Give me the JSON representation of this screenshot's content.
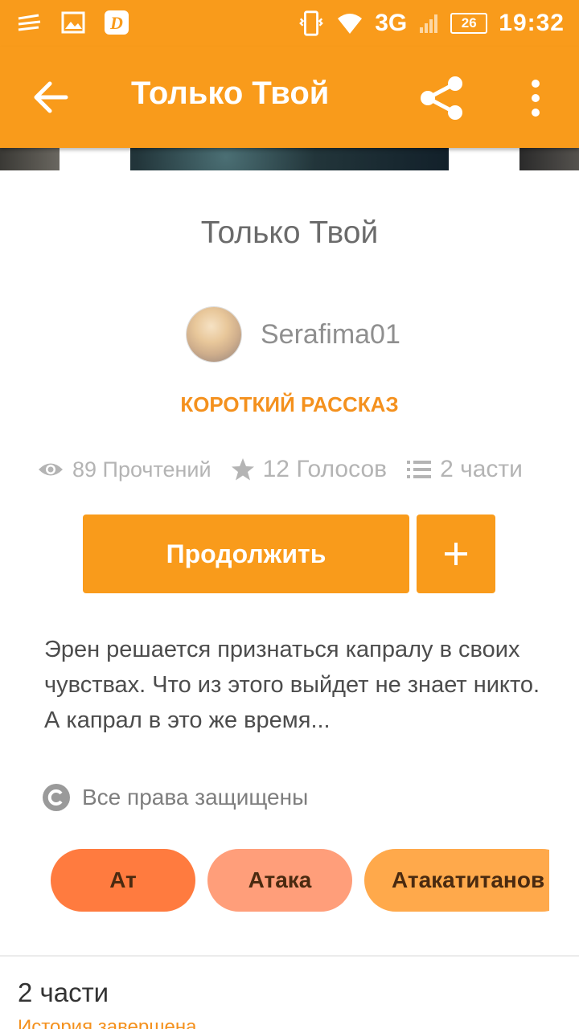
{
  "status_bar": {
    "time": "19:32",
    "network": "3G",
    "battery": "26",
    "left_icons": [
      "notification-icon",
      "image-icon",
      "app-d-icon"
    ],
    "right_icons": [
      "vibrate-icon",
      "wifi-icon",
      "signal-icon",
      "battery-icon"
    ]
  },
  "app_bar": {
    "title": "Только Твой",
    "back_icon": "arrow-left-icon",
    "share_icon": "share-icon",
    "more_icon": "more-vert-icon"
  },
  "story": {
    "title": "Только Твой",
    "author": "Serafima01",
    "category": "КОРОТКИЙ РАССКАЗ",
    "stats": {
      "reads": "89 Прочтений",
      "votes": "12 Голосов",
      "parts": "2 части"
    },
    "continue_label": "Продолжить",
    "add_label": "+",
    "description": "Эрен решается признаться капралу в своих чувствах. Что из этого выйдет не знает никто. А капрал в это же время...",
    "copyright": "Все права защищены",
    "tags": [
      "Ат",
      "Атака",
      "Атакатитанов"
    ]
  },
  "parts_section": {
    "title": "2 части",
    "status": "История завершена"
  },
  "colors": {
    "accent": "#f99b1b",
    "accent_text": "#f4911e",
    "tag1": "#ff7b3f",
    "tag2": "#ff9e7a",
    "tag3": "#ffa94b"
  }
}
